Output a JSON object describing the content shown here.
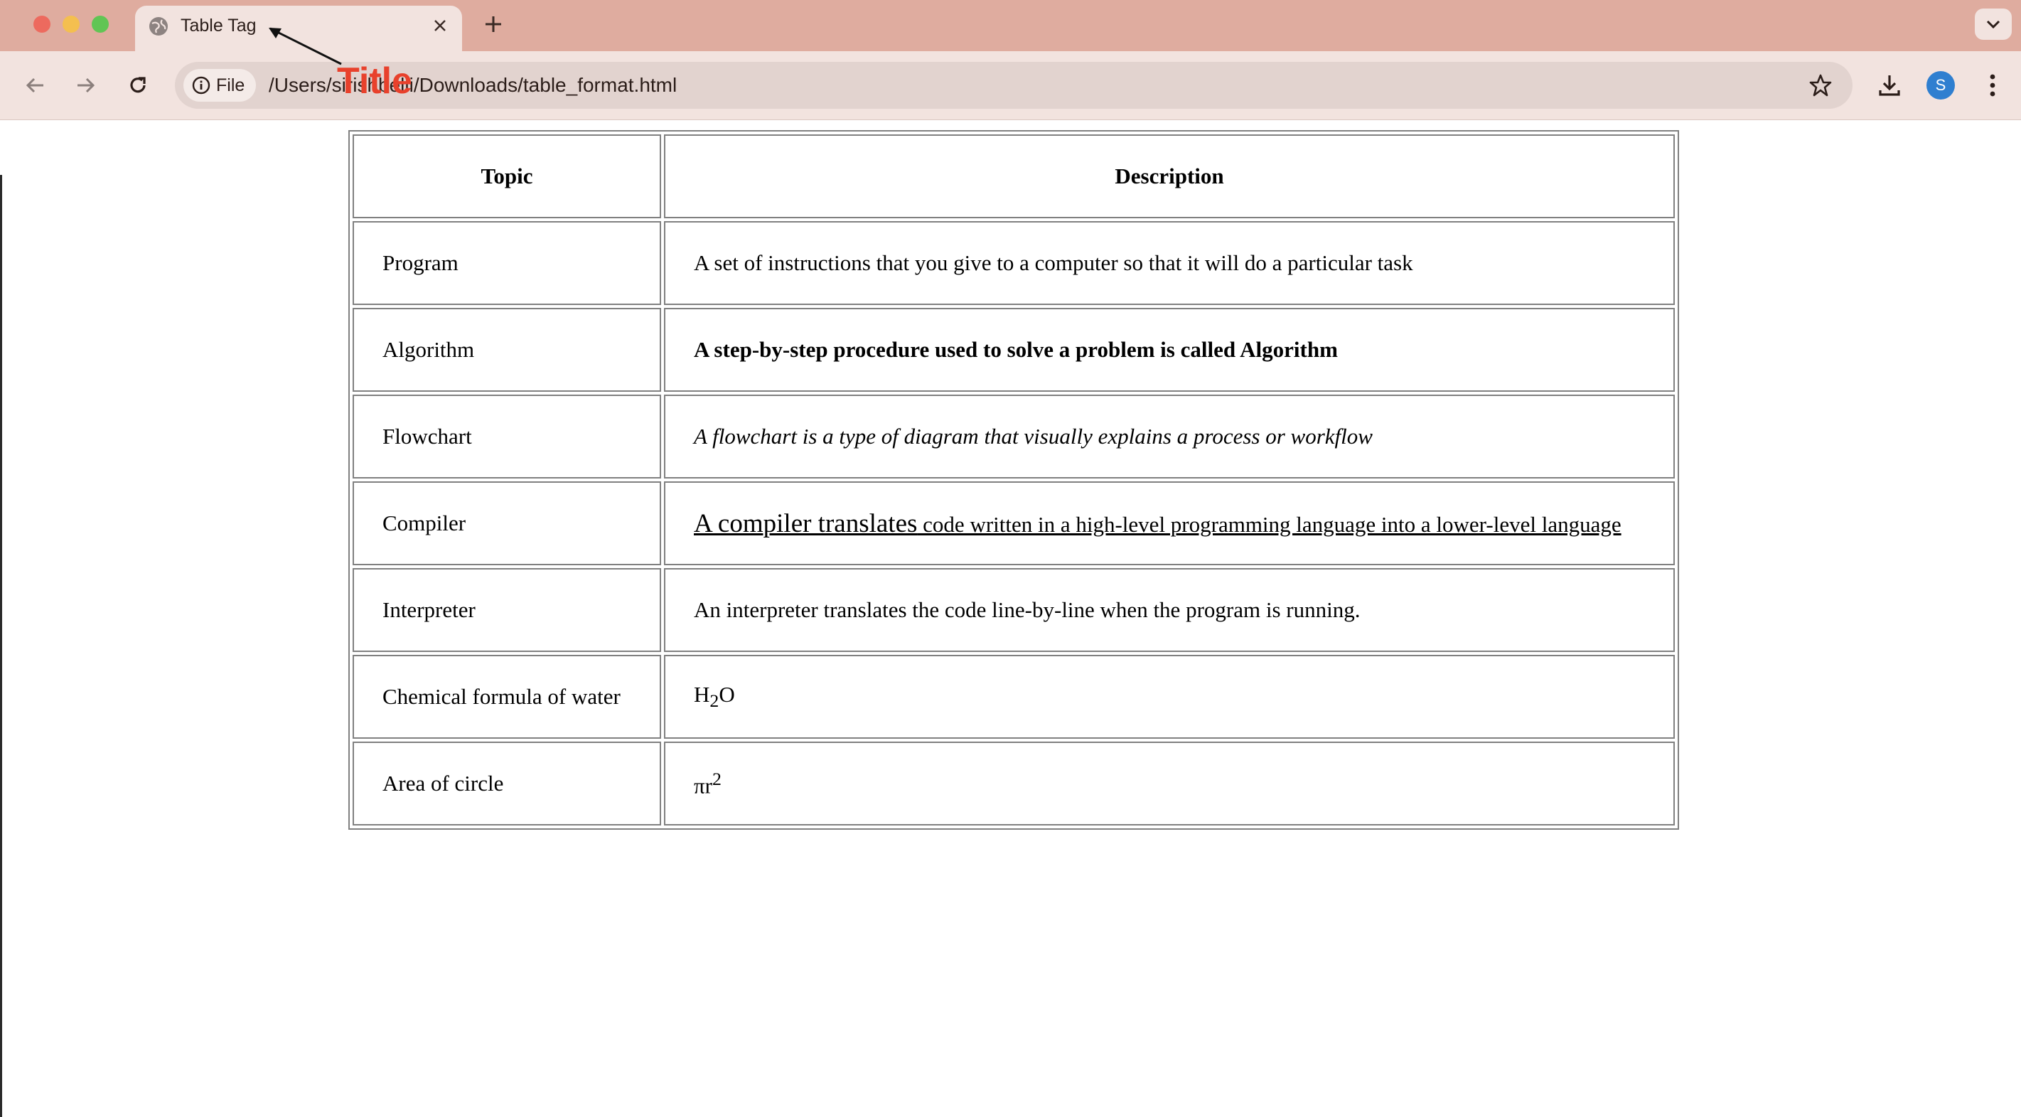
{
  "browser": {
    "tab": {
      "title": "Table Tag",
      "close_icon": "close-icon",
      "favicon": "globe-icon"
    },
    "new_tab_icon": "plus-icon",
    "tab_search_icon": "chevron-down-icon",
    "toolbar": {
      "back_icon": "arrow-left-icon",
      "forward_icon": "arrow-right-icon",
      "reload_icon": "reload-icon",
      "site_chip_label": "File",
      "url": "/Users/sirishbelli/Downloads/table_format.html",
      "bookmark_icon": "star-icon",
      "download_icon": "download-icon",
      "profile_initial": "S",
      "menu_icon": "kebab-menu-icon"
    },
    "colors": {
      "tabstrip": "#dfac9f",
      "toolbar": "#f2e3df",
      "annotation": "#e8412c",
      "profile": "#2f7fd0"
    }
  },
  "annotation": {
    "label": "Title"
  },
  "table": {
    "headers": [
      "Topic",
      "Description"
    ],
    "rows": [
      {
        "topic": "Program",
        "description": "A set of instructions that you give to a computer so that it will do a particular task"
      },
      {
        "topic": "Algorithm",
        "description": "A step-by-step procedure used to solve a problem is called Algorithm"
      },
      {
        "topic": "Flowchart",
        "description": "A flowchart is a type of diagram that visually explains a process or workflow"
      },
      {
        "topic": "Compiler",
        "description_big": "A compiler translates",
        "description_rest": " code written in a high-level programming language into a lower-level language"
      },
      {
        "topic": "Interpreter",
        "description": "An interpreter translates the code line-by-line when the program is running."
      },
      {
        "topic": "Chemical formula of water",
        "formula_base1": "H",
        "formula_sub": "2",
        "formula_base2": "O"
      },
      {
        "topic": "Area of circle",
        "formula_base": "πr",
        "formula_sup": "2"
      }
    ]
  }
}
